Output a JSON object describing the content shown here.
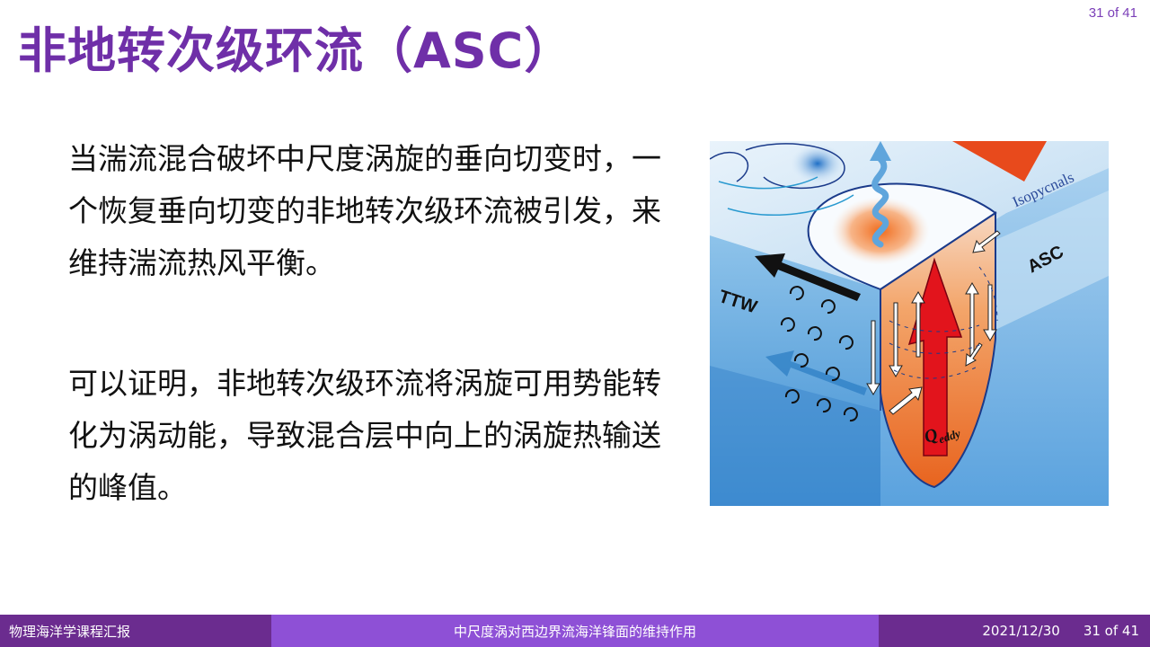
{
  "page": {
    "counter": "31 of 41",
    "title": "非地转次级环流（ASC）"
  },
  "content": {
    "paragraph1": "当湍流混合破坏中尺度涡旋的垂向切变时，一个恢复垂向切变的非地转次级环流被引发，来维持湍流热风平衡。",
    "paragraph2": "可以证明，非地转次级环流将涡旋可用势能转化为涡动能，导致混合层中向上的涡旋热输送的峰值。"
  },
  "figure": {
    "label_isopycnals": "Isopycnals",
    "label_asc": "ASC",
    "label_ttw": "TTW",
    "label_q": "Q",
    "label_q_sub": "eddy"
  },
  "footer": {
    "left": "物理海洋学课程汇报",
    "center": "中尺度涡对西边界流海洋锋面的维持作用",
    "date": "2021/12/30",
    "page": "31 of 41"
  },
  "colors": {
    "title": "#6f2fa8",
    "footer_dark": "#6b2c8f",
    "footer_mid": "#8e50d6"
  }
}
